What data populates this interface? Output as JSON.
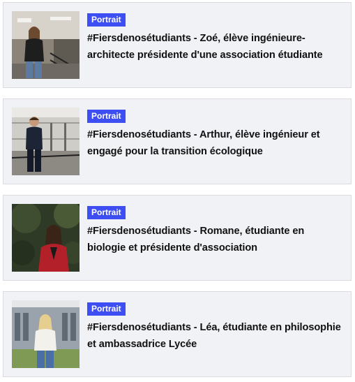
{
  "articles": [
    {
      "badge": "Portrait",
      "title": "#Fiersdenosétudiants - Zoé, élève ingénieure-architecte présidente d'une association étudiante",
      "image_icon": "student-photo-zoe"
    },
    {
      "badge": "Portrait",
      "title": "#Fiersdenosétudiants - Arthur, élève ingénieur et engagé pour la transition écologique",
      "image_icon": "student-photo-arthur"
    },
    {
      "badge": "Portrait",
      "title": "#Fiersdenosétudiants - Romane, étudiante en biologie et présidente d'association",
      "image_icon": "student-photo-romane"
    },
    {
      "badge": "Portrait",
      "title": "#Fiersdenosétudiants - Léa, étudiante en philosophie et ambassadrice Lycée",
      "image_icon": "student-photo-lea"
    }
  ],
  "colors": {
    "badge_bg": "#3d4ef2",
    "card_bg": "#f1f2f6",
    "card_border": "#d9dbe1",
    "title_text": "#111111"
  }
}
